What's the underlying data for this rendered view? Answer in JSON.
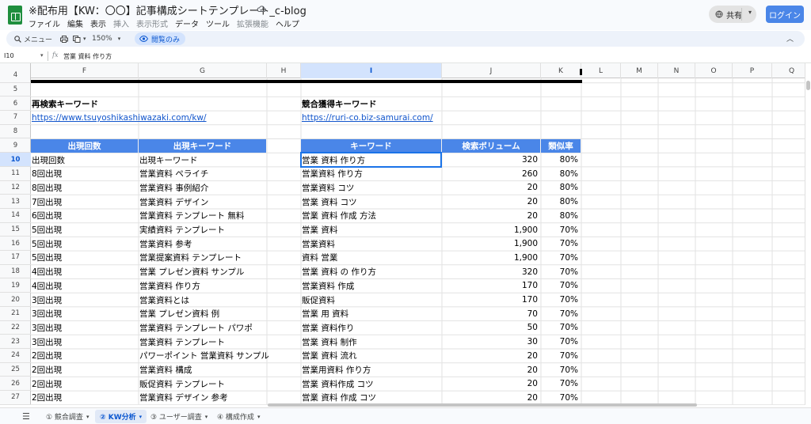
{
  "window": {
    "title": "※配布用【KW：〇〇】記事構成シートテンプレート_c-blog",
    "menus": [
      {
        "label": "ファイル",
        "enabled": true
      },
      {
        "label": "編集",
        "enabled": true
      },
      {
        "label": "表示",
        "enabled": true
      },
      {
        "label": "挿入",
        "enabled": false
      },
      {
        "label": "表示形式",
        "enabled": false
      },
      {
        "label": "データ",
        "enabled": true
      },
      {
        "label": "ツール",
        "enabled": true
      },
      {
        "label": "拡張機能",
        "enabled": false
      },
      {
        "label": "ヘルプ",
        "enabled": true
      }
    ],
    "share_label": "共有",
    "login_label": "ログイン"
  },
  "toolbar": {
    "menu_search": "メニュー",
    "zoom": "150%",
    "view_only": "閲覧のみ"
  },
  "formula_bar": {
    "cell_ref": "I10",
    "value": "営業 資料 作り方"
  },
  "columns": [
    {
      "label": "F",
      "selected": false
    },
    {
      "label": "G",
      "selected": false
    },
    {
      "label": "H",
      "selected": false
    },
    {
      "label": "I",
      "selected": true
    },
    {
      "label": "J",
      "selected": false
    },
    {
      "label": "K",
      "selected": false
    },
    {
      "label": "L",
      "selected": false
    },
    {
      "label": "M",
      "selected": false
    },
    {
      "label": "N",
      "selected": false
    },
    {
      "label": "O",
      "selected": false
    },
    {
      "label": "P",
      "selected": false
    },
    {
      "label": "Q",
      "selected": false
    }
  ],
  "rows": [
    "4",
    "5",
    "6",
    "7",
    "8",
    "9",
    "10",
    "11",
    "12",
    "13",
    "14",
    "15",
    "16",
    "17",
    "18",
    "19",
    "20",
    "21",
    "22",
    "23",
    "24",
    "25",
    "26",
    "27"
  ],
  "selected_row": "10",
  "sections": {
    "related_title": "再検索キーワード",
    "related_url": "https://www.tsuyoshikashiwazaki.com/kw/",
    "competitor_title": "競合獲得キーワード",
    "competitor_url": "https://ruri-co.biz-samurai.com/"
  },
  "left_table": {
    "headers": [
      "出現回数",
      "出現キーワード"
    ],
    "rows": [
      [
        "出現回数",
        "出現キーワード"
      ],
      [
        "8回出現",
        "営業資料 ペライチ"
      ],
      [
        "8回出現",
        "営業資料 事例紹介"
      ],
      [
        "7回出現",
        "営業資料 デザイン"
      ],
      [
        "6回出現",
        "営業資料 テンプレート 無料"
      ],
      [
        "5回出現",
        "実績資料 テンプレート"
      ],
      [
        "5回出現",
        "営業資料 参考"
      ],
      [
        "5回出現",
        "営業提案資料 テンプレート"
      ],
      [
        "4回出現",
        "営業 プレゼン資料 サンプル"
      ],
      [
        "4回出現",
        "営業資料 作り方"
      ],
      [
        "3回出現",
        "営業資料とは"
      ],
      [
        "3回出現",
        "営業 プレゼン資料 例"
      ],
      [
        "3回出現",
        "営業資料 テンプレート パワポ"
      ],
      [
        "3回出現",
        "営業資料 テンプレート"
      ],
      [
        "2回出現",
        "パワーポイント 営業資料 サンプル"
      ],
      [
        "2回出現",
        "営業資料 構成"
      ],
      [
        "2回出現",
        "販促資料 テンプレート"
      ],
      [
        "2回出現",
        "営業資料 デザイン 参考"
      ]
    ]
  },
  "right_table": {
    "headers": [
      "キーワード",
      "検索ボリューム",
      "類似率"
    ],
    "rows": [
      [
        "営業 資料 作り方",
        "320",
        "80%"
      ],
      [
        "営業資料 作り方",
        "260",
        "80%"
      ],
      [
        "営業資料 コツ",
        "20",
        "80%"
      ],
      [
        "営業 資料 コツ",
        "20",
        "80%"
      ],
      [
        "営業 資料 作成 方法",
        "20",
        "80%"
      ],
      [
        "営業 資料",
        "1,900",
        "70%"
      ],
      [
        "営業資料",
        "1,900",
        "70%"
      ],
      [
        "資料 営業",
        "1,900",
        "70%"
      ],
      [
        "営業 資料 の 作り方",
        "320",
        "70%"
      ],
      [
        "営業資料 作成",
        "170",
        "70%"
      ],
      [
        "販促資料",
        "170",
        "70%"
      ],
      [
        "営業 用 資料",
        "70",
        "70%"
      ],
      [
        "営業 資料作り",
        "50",
        "70%"
      ],
      [
        "営業 資料 制作",
        "30",
        "70%"
      ],
      [
        "営業 資料 流れ",
        "20",
        "70%"
      ],
      [
        "営業用資料 作り方",
        "20",
        "70%"
      ],
      [
        "営業 資料作成 コツ",
        "20",
        "70%"
      ],
      [
        "営業 資料 作成 コツ",
        "20",
        "70%"
      ]
    ]
  },
  "sheet_tabs": [
    {
      "label": "① 競合調査",
      "active": false
    },
    {
      "label": "② KW分析",
      "active": true
    },
    {
      "label": "③ ユーザー調査",
      "active": false
    },
    {
      "label": "④ 構成作成",
      "active": false
    }
  ],
  "colors": {
    "header_bg": "#4a86e8",
    "link": "#1155cc",
    "selection": "#1a73e8"
  }
}
